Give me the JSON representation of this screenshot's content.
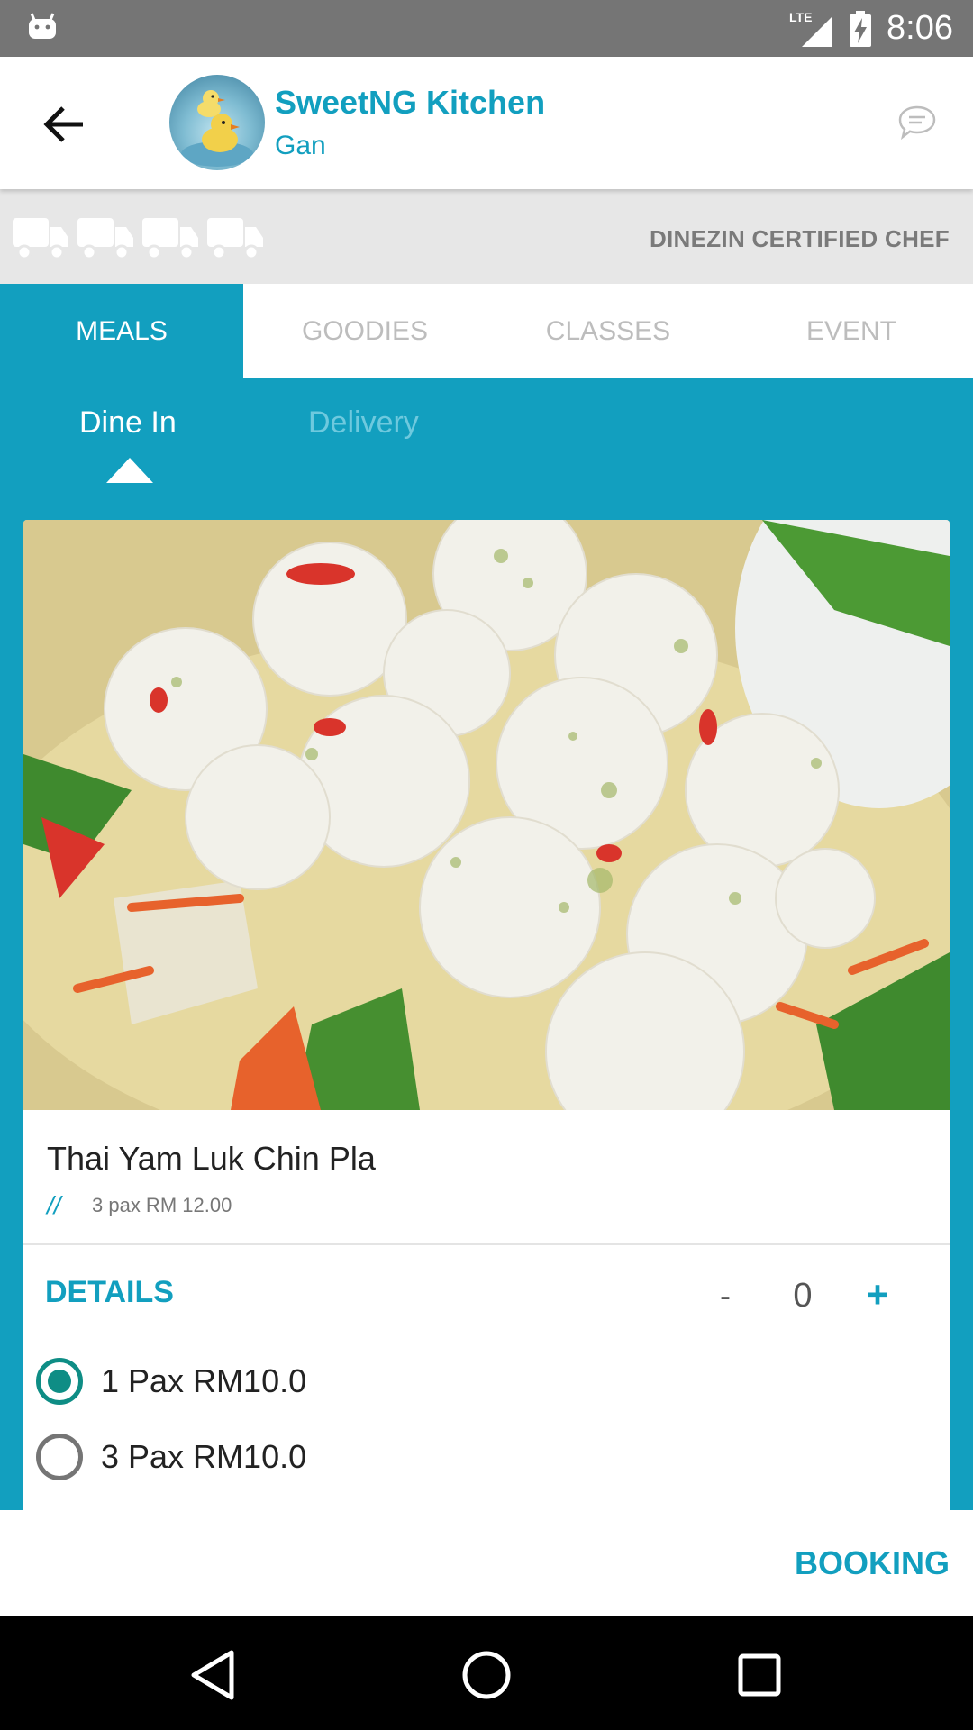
{
  "status_bar": {
    "network": "LTE",
    "time": "8:06"
  },
  "header": {
    "title": "SweetNG Kitchen",
    "subtitle": "Gan"
  },
  "certification": {
    "label": "DINEZIN CERTIFIED CHEF"
  },
  "tabs": [
    {
      "label": "MEALS",
      "active": true
    },
    {
      "label": "GOODIES",
      "active": false
    },
    {
      "label": "CLASSES",
      "active": false
    },
    {
      "label": "EVENT",
      "active": false
    }
  ],
  "subtabs": [
    {
      "label": "Dine In",
      "active": true
    },
    {
      "label": "Delivery",
      "active": false
    }
  ],
  "meal": {
    "title": "Thai Yam Luk Chin Pla",
    "price_marker": "//",
    "price_text": "3 pax RM 12.00",
    "details_label": "DETAILS",
    "qty_minus": "-",
    "qty_value": "0",
    "qty_plus": "+",
    "options": [
      {
        "label": "1 Pax RM10.0",
        "selected": true
      },
      {
        "label": "3 Pax RM10.0",
        "selected": false
      }
    ]
  },
  "footer": {
    "booking_label": "BOOKING"
  },
  "colors": {
    "accent": "#129fbf",
    "radio_selected": "#0e8d85"
  }
}
